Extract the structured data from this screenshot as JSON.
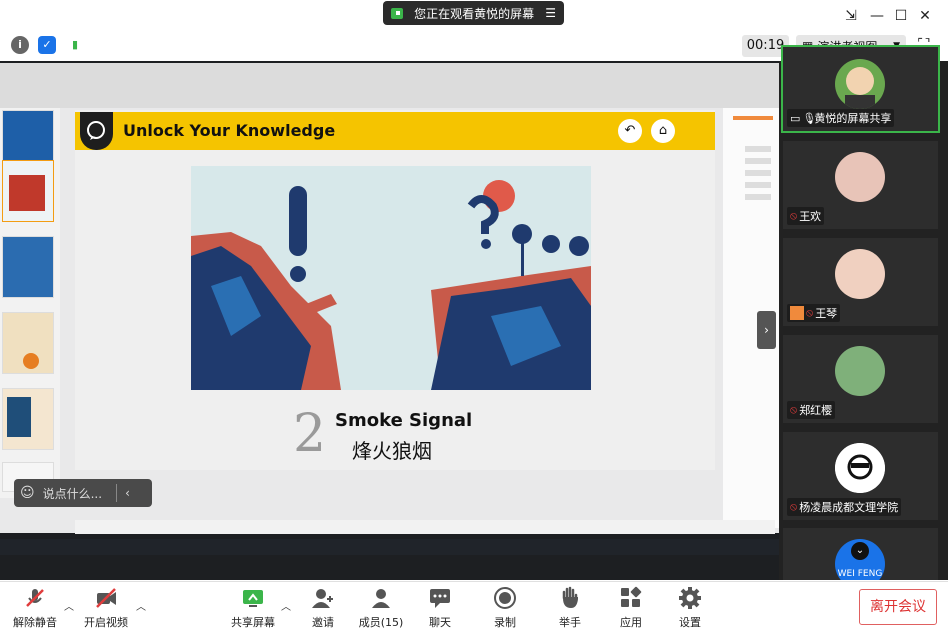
{
  "top": {
    "share_banner": "您正在观看黄悦的屏幕",
    "timer": "00:19",
    "view_mode": "演讲者视图"
  },
  "slide": {
    "title": "Unlock Your Knowledge",
    "number": "2",
    "title_en": "Smoke Signal",
    "title_cn": "烽火狼烟"
  },
  "chat": {
    "placeholder": "说点什么..."
  },
  "participants": [
    {
      "name": "黄悦的屏幕共享"
    },
    {
      "name": "王欢"
    },
    {
      "name": "王琴"
    },
    {
      "name": "郑红樱"
    },
    {
      "name": "杨凌晨成都文理学院"
    },
    {
      "name": "WEI FENG"
    }
  ],
  "toolbar": {
    "mute": "解除静音",
    "video": "开启视频",
    "share": "共享屏幕",
    "invite": "邀请",
    "members": "成员(15)",
    "chat": "聊天",
    "record": "录制",
    "raise_hand": "举手",
    "apps": "应用",
    "settings": "设置",
    "leave": "离开会议"
  },
  "colors": {
    "accent_green": "#3bb54a",
    "slide_yellow": "#f5c400",
    "leave_red": "#d33333",
    "mute_red": "#e03c3c"
  }
}
